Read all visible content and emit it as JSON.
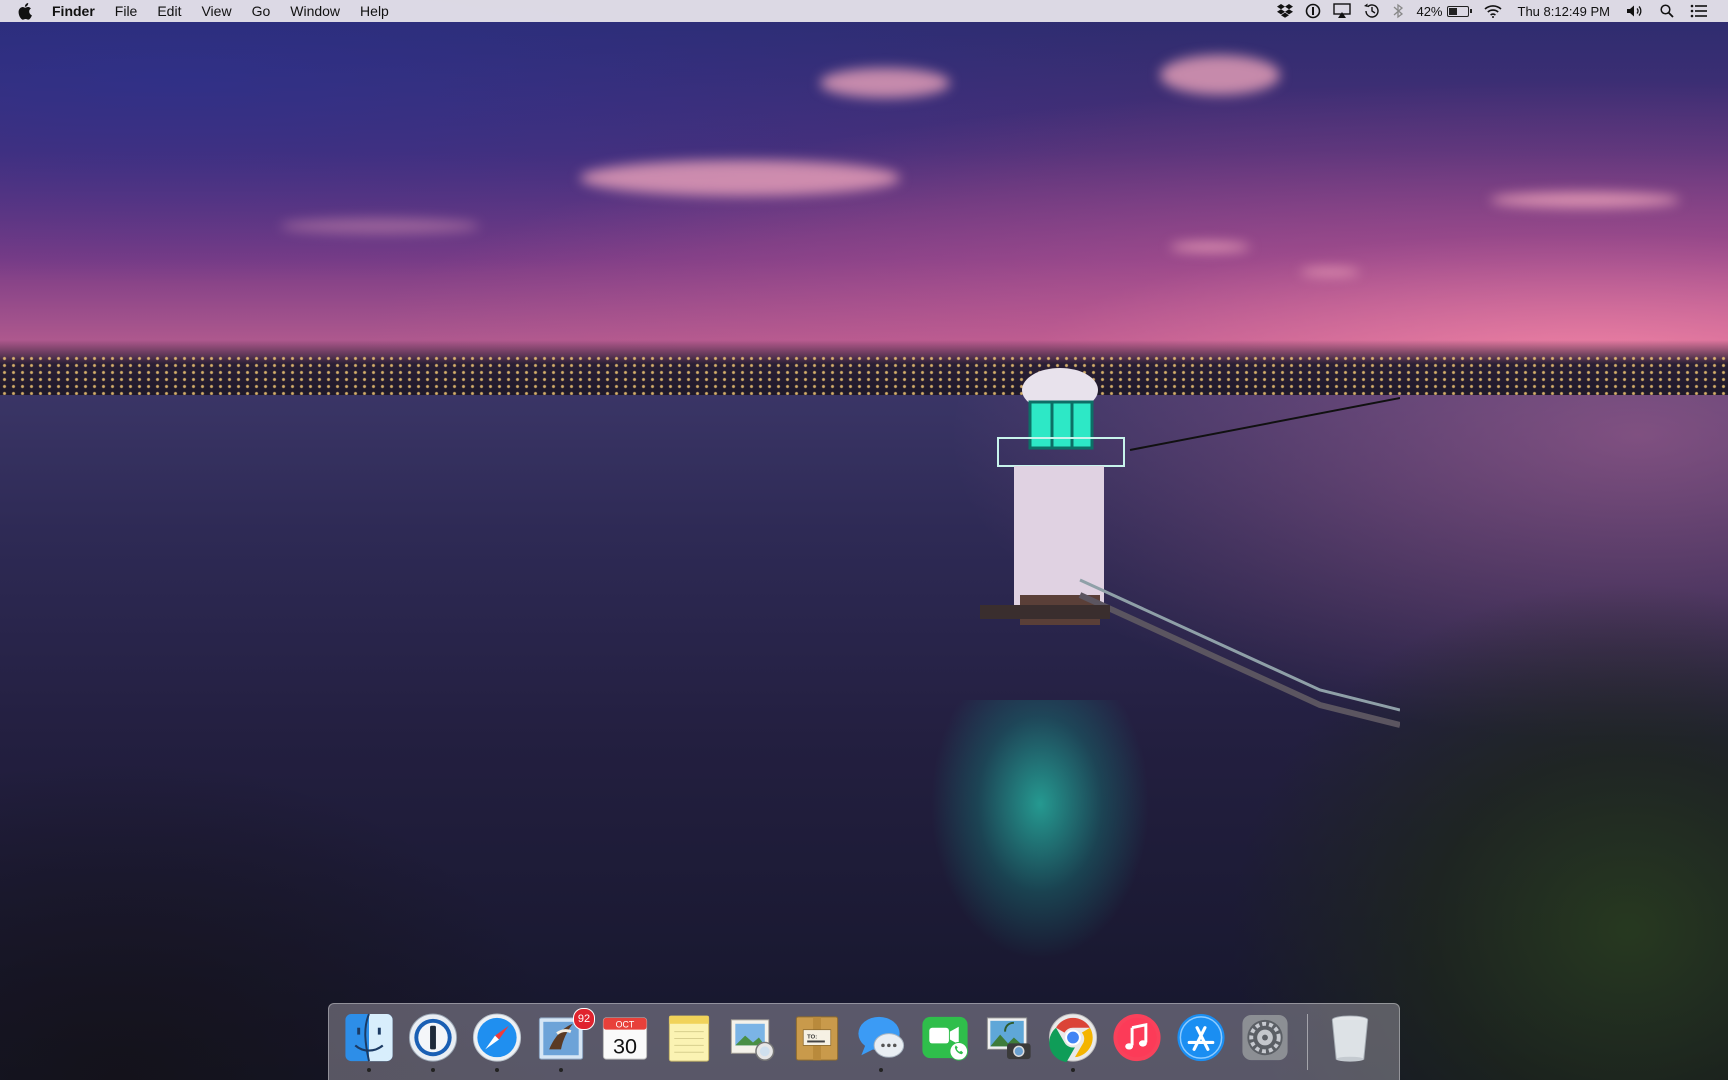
{
  "menubar": {
    "app_name": "Finder",
    "menus": [
      "File",
      "Edit",
      "View",
      "Go",
      "Window",
      "Help"
    ],
    "status": {
      "battery_percent": "42%",
      "battery_level": 0.42,
      "clock": "Thu 8:12:49 PM",
      "icons": [
        "dropbox-icon",
        "1password-mini-icon",
        "airplay-icon",
        "time-machine-icon",
        "bluetooth-icon",
        "battery-icon",
        "wifi-icon",
        "volume-icon",
        "spotlight-icon",
        "notification-center-icon"
      ]
    }
  },
  "dock": {
    "apps": [
      {
        "name": "Finder",
        "icon": "finder-icon",
        "running": true
      },
      {
        "name": "1Password",
        "icon": "1password-icon",
        "running": true
      },
      {
        "name": "Safari",
        "icon": "safari-icon",
        "running": true
      },
      {
        "name": "Mail",
        "icon": "mail-icon",
        "running": true,
        "badge": "92"
      },
      {
        "name": "Calendar",
        "icon": "calendar-icon",
        "running": false,
        "month": "OCT",
        "day": "30"
      },
      {
        "name": "Notes",
        "icon": "notes-icon",
        "running": false
      },
      {
        "name": "Preview",
        "icon": "preview-icon",
        "running": false
      },
      {
        "name": "Deliveries",
        "icon": "package-icon",
        "running": false,
        "label": "TO:"
      },
      {
        "name": "Messages",
        "icon": "messages-icon",
        "running": true
      },
      {
        "name": "FaceTime",
        "icon": "facetime-icon",
        "running": false
      },
      {
        "name": "Image Capture",
        "icon": "image-capture-icon",
        "running": false
      },
      {
        "name": "Google Chrome",
        "icon": "chrome-icon",
        "running": true
      },
      {
        "name": "iTunes",
        "icon": "itunes-icon",
        "running": false
      },
      {
        "name": "App Store",
        "icon": "app-store-icon",
        "running": false
      },
      {
        "name": "System Preferences",
        "icon": "system-preferences-icon",
        "running": false
      }
    ],
    "trash": {
      "name": "Trash",
      "icon": "trash-icon"
    }
  }
}
